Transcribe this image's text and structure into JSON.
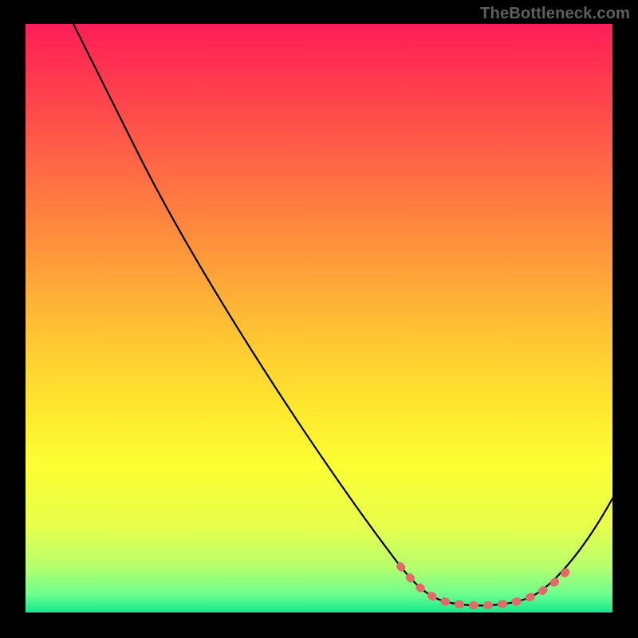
{
  "watermark": "TheBottleneck.com",
  "colors": {
    "gradient_top": "#ff1e58",
    "gradient_mid": "#ffe42e",
    "gradient_bottom": "#14e78e",
    "curve": "#000000",
    "highlight_dots": "#e46a6a",
    "frame": "#000000"
  },
  "chart_data": {
    "type": "line",
    "title": "",
    "xlabel": "",
    "ylabel": "",
    "xlim": [
      0,
      100
    ],
    "ylim": [
      0,
      100
    ],
    "background": "vertical gradient red→yellow→green representing bottleneck severity (top=high, bottom=low)",
    "series": [
      {
        "name": "bottleneck-curve",
        "x": [
          8,
          12,
          19,
          30,
          40,
          50,
          58,
          64,
          68,
          72,
          76,
          80,
          84,
          88,
          92,
          96,
          100
        ],
        "y": [
          100,
          92,
          78,
          57,
          42,
          28,
          18,
          10,
          5,
          2,
          1,
          1,
          2,
          4,
          8,
          14,
          20
        ]
      },
      {
        "name": "optimal-range-highlight",
        "style": "dotted",
        "x": [
          64,
          68,
          72,
          76,
          80,
          84,
          88,
          92
        ],
        "y": [
          10,
          5,
          2,
          1,
          1,
          2,
          4,
          8
        ]
      }
    ],
    "annotations": []
  }
}
